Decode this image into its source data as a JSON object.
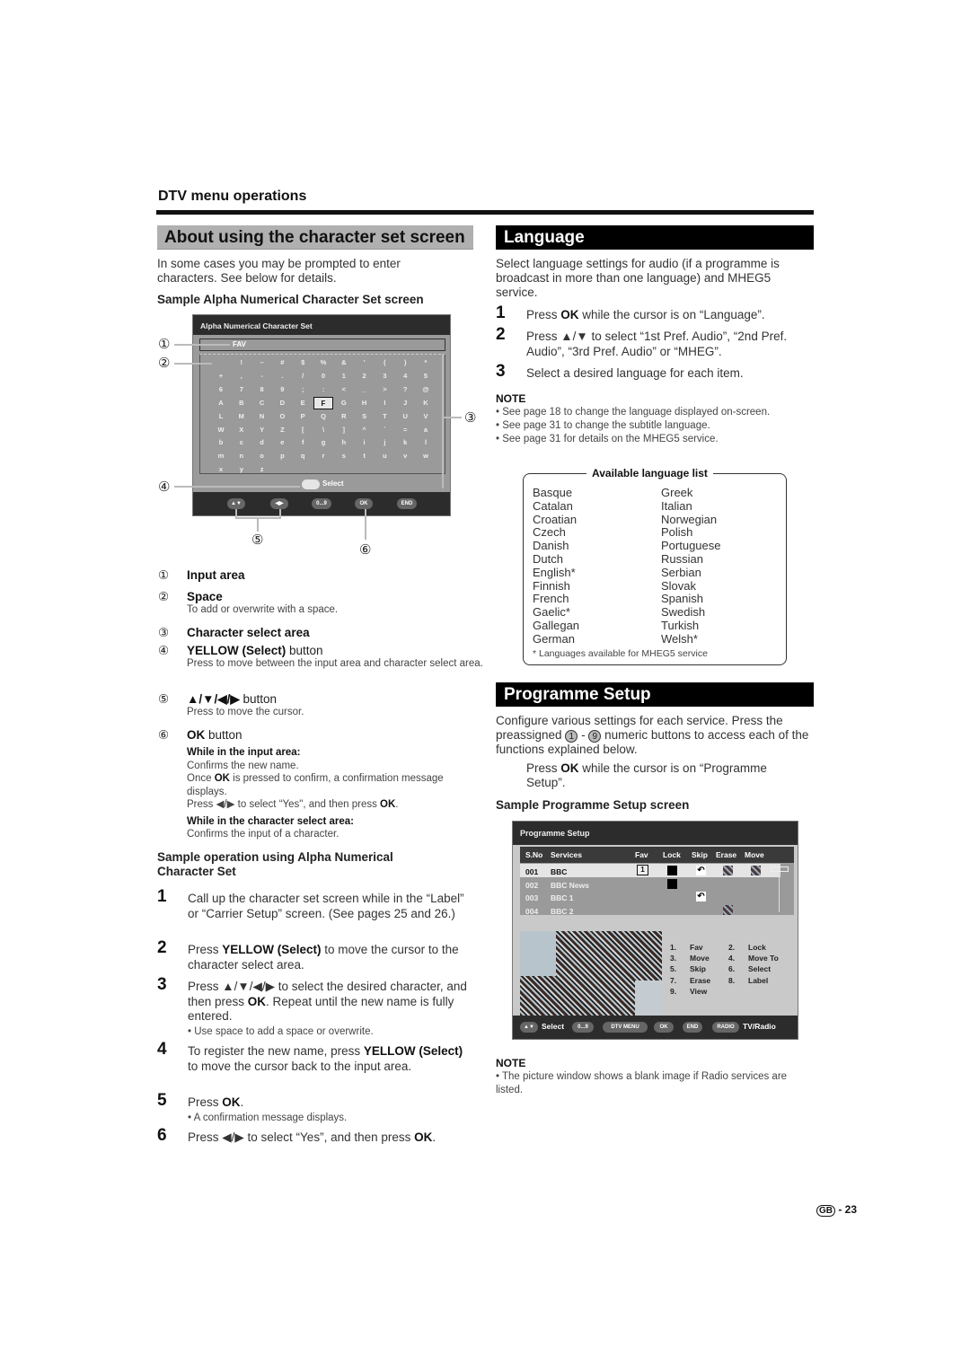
{
  "section_header": "DTV menu operations",
  "left": {
    "title": "About using the character set screen",
    "intro": "In some cases you may be prompted to enter characters. See below for details.",
    "sample_heading": "Sample Alpha Numerical Character Set screen",
    "screen": {
      "title": "Alpha Numerical Character Set",
      "input_value": "FAV",
      "selected_char": "F",
      "rows": [
        [
          " ",
          "!",
          "–",
          "#",
          "$",
          "%",
          "&",
          "'",
          "(",
          ")",
          "*"
        ],
        [
          "+",
          ",",
          "-",
          ".",
          "/",
          "0",
          "1",
          "2",
          "3",
          "4",
          "5"
        ],
        [
          "6",
          "7",
          "8",
          "9",
          ";",
          ":",
          "<",
          "_",
          ">",
          "?",
          "@"
        ],
        [
          "A",
          "B",
          "C",
          "D",
          "E",
          "F",
          "G",
          "H",
          "I",
          "J",
          "K"
        ],
        [
          "L",
          "M",
          "N",
          "O",
          "P",
          "Q",
          "R",
          "S",
          "T",
          "U",
          "V"
        ],
        [
          "W",
          "X",
          "Y",
          "Z",
          "[",
          "\\",
          "]",
          "^",
          "`",
          "=",
          "a"
        ],
        [
          "b",
          "c",
          "d",
          "e",
          "f",
          "g",
          "h",
          "i",
          "j",
          "k",
          "l"
        ],
        [
          "m",
          "n",
          "o",
          "p",
          "q",
          "r",
          "s",
          "t",
          "u",
          "v",
          "w"
        ],
        [
          "x",
          "y",
          "z"
        ]
      ],
      "select_label": "Select",
      "footer_buttons": [
        "▲▼",
        "◀▶",
        "0...9",
        "OK",
        "END"
      ],
      "callouts": [
        "①",
        "②",
        "③",
        "④",
        "⑤",
        "⑥"
      ]
    },
    "legend": [
      {
        "num": "①",
        "label": "Input area",
        "desc": ""
      },
      {
        "num": "②",
        "label": "Space",
        "desc": "To add or overwrite with a space."
      },
      {
        "num": "③",
        "label": "Character select area",
        "desc": ""
      },
      {
        "num": "④",
        "label_bold": "YELLOW (Select)",
        "label_rest": " button",
        "desc": "Press to move between the input area and character select area."
      },
      {
        "num": "⑤",
        "label_bold": "▲/▼/◀/▶",
        "label_rest": " button",
        "desc": "Press to move the cursor."
      },
      {
        "num": "⑥",
        "label_bold": "OK",
        "label_rest": " button"
      }
    ],
    "ok_details": {
      "input_heading": "While in the input area:",
      "input_line1": "Confirms the new name.",
      "input_line2_pre": "Once ",
      "input_line2_bold": "OK",
      "input_line2_post": " is pressed to confirm, a confirmation message displays.",
      "input_line3_pre": "Press ◀/▶ to select “Yes\", and then press ",
      "input_line3_bold": "OK",
      "input_line3_post": ".",
      "char_heading": "While in the character select area:",
      "char_line": "Confirms the input of a character."
    },
    "op_heading": "Sample operation using Alpha Numerical Character Set",
    "steps": [
      {
        "num": "1",
        "text": "Call up the character set screen while in the “Label” or “Carrier Setup” screen. (See pages 25 and 26.)"
      },
      {
        "num": "2",
        "pre": "Press ",
        "bold": "YELLOW (Select)",
        "post": " to move the cursor to the character select area."
      },
      {
        "num": "3",
        "pre": "Press ▲/▼/◀/▶ to select the desired character, and then press ",
        "bold": "OK",
        "post": ". Repeat until the new name is fully entered.",
        "note": "• Use space to add a space or overwrite."
      },
      {
        "num": "4",
        "pre": "To register the new name, press ",
        "bold": "YELLOW (Select)",
        "post": " to move the cursor back to the input area."
      },
      {
        "num": "5",
        "pre": "Press ",
        "bold": "OK",
        "post": ".",
        "note": "• A confirmation message displays."
      },
      {
        "num": "6",
        "pre": "Press ◀/▶ to select “Yes”, and then press ",
        "bold": "OK",
        "post": "."
      }
    ]
  },
  "language": {
    "title": "Language",
    "intro": "Select language settings for audio (if a programme is broadcast in more than one language) and MHEG5 service.",
    "steps": [
      {
        "num": "1",
        "pre": "Press ",
        "bold": "OK",
        "post": " while the cursor is on “Language”."
      },
      {
        "num": "2",
        "text": "Press ▲/▼ to select “1st Pref. Audio”, “2nd Pref. Audio”, “3rd Pref. Audio” or “MHEG”."
      },
      {
        "num": "3",
        "text": "Select a desired language for each item."
      }
    ],
    "note_title": "NOTE",
    "notes": [
      "• See page 18 to change the language displayed on-screen.",
      "• See page 31 to change the subtitle language.",
      "• See page 31 for details on the MHEG5 service."
    ],
    "list_title": "Available language list",
    "col1": [
      "Basque",
      "Catalan",
      "Croatian",
      "Czech",
      "Danish",
      "Dutch",
      "English*",
      "Finnish",
      "French",
      "Gaelic*",
      "Gallegan",
      "German"
    ],
    "col2": [
      "Greek",
      "Italian",
      "Norwegian",
      "Polish",
      "Portuguese",
      "Russian",
      "Serbian",
      "Slovak",
      "Spanish",
      "Swedish",
      "Turkish",
      "Welsh*"
    ],
    "list_footnote": "*  Languages available for MHEG5 service"
  },
  "programme": {
    "title": "Programme Setup",
    "intro_pre": "Configure various settings for each service. Press the preassigned ",
    "btn1": "1",
    "dash": " - ",
    "btn9": "9",
    "intro_post": " numeric buttons to access each of the functions explained below.",
    "step_pre": "Press ",
    "step_bold": "OK",
    "step_post": " while the cursor is on “Programme Setup”.",
    "sample_heading": "Sample Programme Setup screen",
    "screen": {
      "title": "Programme Setup",
      "columns": [
        "S.No",
        "Services",
        "Fav",
        "Lock",
        "Skip",
        "Erase",
        "Move"
      ],
      "rows": [
        {
          "sno": "001",
          "service": "BBC",
          "fav": "1",
          "lock": true,
          "skip": true,
          "erase": true,
          "move": true
        },
        {
          "sno": "002",
          "service": "BBC News",
          "fav": "",
          "lock": true,
          "skip": false,
          "erase": false,
          "move": false
        },
        {
          "sno": "003",
          "service": "BBC 1",
          "fav": "",
          "lock": false,
          "skip": true,
          "erase": false,
          "move": false
        },
        {
          "sno": "004",
          "service": "BBC 2",
          "fav": "",
          "lock": false,
          "skip": false,
          "erase": true,
          "move": false
        }
      ],
      "functions": [
        [
          "1.",
          "Fav",
          "2.",
          "Lock"
        ],
        [
          "3.",
          "Move",
          "4.",
          "Move To"
        ],
        [
          "5.",
          "Skip",
          "6.",
          "Select"
        ],
        [
          "7.",
          "Erase",
          "8.",
          "Label"
        ],
        [
          "9.",
          "View",
          "",
          ""
        ]
      ],
      "footer": {
        "nav": "▲▼",
        "select": "Select",
        "num": "0...9",
        "menu": "DTV MENU",
        "ok": "OK",
        "end": "END",
        "radio": "RADIO",
        "tvradio": "TV/Radio"
      }
    },
    "note_title": "NOTE",
    "note": "• The picture window shows a blank image if Radio services are listed."
  },
  "footer": {
    "region": "GB",
    "page": "- 23"
  }
}
